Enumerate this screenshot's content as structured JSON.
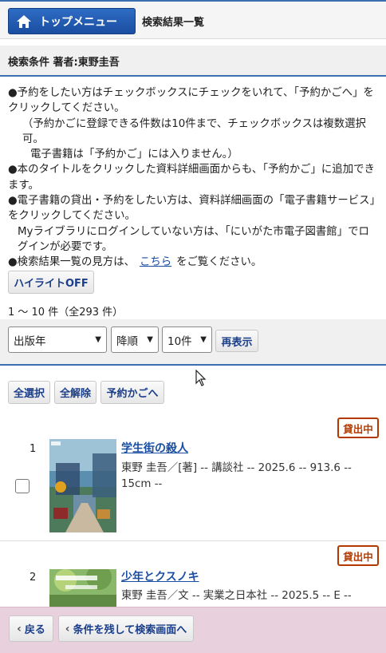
{
  "header": {
    "top_menu_label": "トップメニュー",
    "page_title": "検索結果一覧"
  },
  "search_conditions": "検索条件 著者:東野圭吾",
  "notes": {
    "line1": "●予約をしたい方はチェックボックスにチェックをいれて、「予約かごへ」をクリックしてください。",
    "line2": "（予約かごに登録できる件数は10件まで、チェックボックスは複数選択可。",
    "line3": "電子書籍は「予約かご」には入りません。）",
    "line4": "●本のタイトルをクリックした資料詳細画面からも、「予約かご」に追加できます。",
    "line5": "●電子書籍の貸出・予約をしたい方は、資料詳細画面の「電子書籍サービス」をクリックしてください。",
    "line6": "Myライブラリにログインしていない方は、「にいがた市電子図書館」でログインが必要です。",
    "line7_prefix": "●検索結果一覧の見方は、",
    "line7_link": "こちら",
    "line7_suffix": "をご覧ください。"
  },
  "highlight_button": "ハイライトOFF",
  "result_count": "1 ～ 10 件（全293 件）",
  "sort": {
    "field_selected": "出版年",
    "order_selected": "降順",
    "per_page_selected": "10件",
    "redisplay_label": "再表示"
  },
  "actions": {
    "select_all": "全選択",
    "deselect_all": "全解除",
    "to_reserve_basket": "予約かごへ"
  },
  "results": [
    {
      "number": "1",
      "status": "貸出中",
      "title": "学生街の殺人",
      "biblio": "東野 圭吾／[著] -- 講談社 -- 2025.6 -- 913.6 -- 15cm --"
    },
    {
      "number": "2",
      "status": "貸出中",
      "title": "少年とクスノキ",
      "biblio": "東野 圭吾／文 -- 実業之日本社 -- 2025.5 -- E --"
    }
  ],
  "footer": {
    "back_label": "戻る",
    "keep_conditions_label": "条件を残して検索画面へ"
  },
  "colors": {
    "accent_blue": "#1a4ea1",
    "status_red": "#b23a00",
    "footer_pink": "#e9d0dd"
  }
}
